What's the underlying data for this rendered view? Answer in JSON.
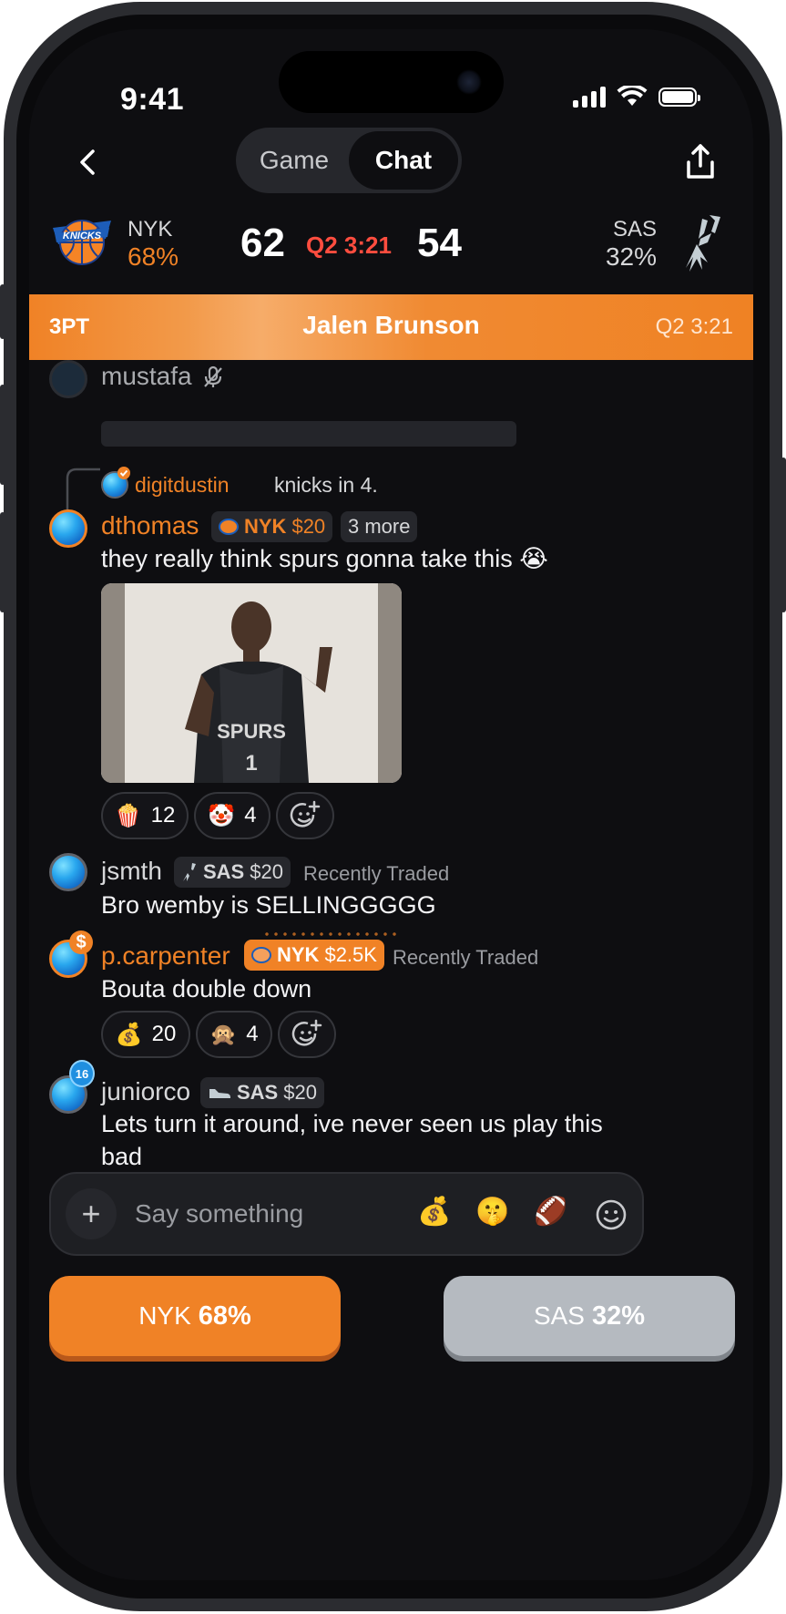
{
  "status_bar": {
    "time": "9:41"
  },
  "nav": {
    "tabs": [
      {
        "label": "Game",
        "active": false
      },
      {
        "label": "Chat",
        "active": true
      }
    ]
  },
  "scoreboard": {
    "home": {
      "abbr": "NYK",
      "pct": "68%",
      "score": "62",
      "color": "#f08226"
    },
    "away": {
      "abbr": "SAS",
      "pct": "32%",
      "score": "54"
    },
    "clock": "Q2 3:21"
  },
  "play_banner": {
    "type": "3PT",
    "player": "Jalen Brunson",
    "time": "Q2 3:21"
  },
  "messages": [
    {
      "user": "mustafa",
      "muted": true
    },
    {
      "reply_user": "digitdustin",
      "reply_text": "knicks in 4."
    },
    {
      "user": "dthomas",
      "badge_team": "NYK",
      "badge_amount": "$20",
      "more": "3 more",
      "text": "they really think spurs gonna take this 😭",
      "reactions": [
        {
          "emoji": "🍿",
          "count": "12"
        },
        {
          "emoji": "🤡",
          "count": "4"
        }
      ]
    },
    {
      "user": "jsmth",
      "badge_team": "SAS",
      "badge_amount": "$20",
      "note": "Recently Traded",
      "text": "Bro wemby is SELLINGGGGG"
    },
    {
      "user": "p.carpenter",
      "badge_team": "NYK",
      "badge_amount": "$2.5K",
      "note": "Recently Traded",
      "text": "Bouta double down",
      "reactions": [
        {
          "emoji": "💰",
          "count": "20"
        },
        {
          "emoji": "🙊",
          "count": "4"
        }
      ]
    },
    {
      "user": "juniorco",
      "level": "16",
      "badge_team": "SAS",
      "badge_amount": "$20",
      "text": "Lets turn it around, ive never seen us play this bad"
    }
  ],
  "composer": {
    "placeholder": "Say something",
    "quick_emojis": [
      "💰",
      "🤫",
      "🏈"
    ]
  },
  "vote": {
    "nyk": {
      "team": "NYK",
      "pct": "68%"
    },
    "sas": {
      "team": "SAS",
      "pct": "32%"
    }
  },
  "colors": {
    "accent": "#f08226",
    "clock_red": "#ff4d3f",
    "background": "#0e0e11"
  }
}
